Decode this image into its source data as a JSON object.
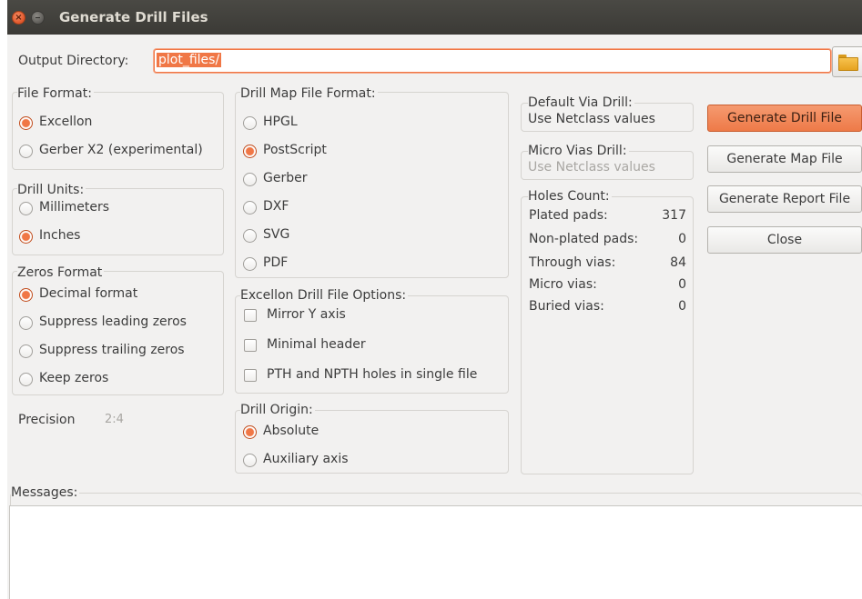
{
  "window": {
    "title": "Generate Drill Files"
  },
  "output": {
    "label": "Output Directory:",
    "value": "plot_files/"
  },
  "file_format": {
    "title": "File Format:",
    "options": [
      "Excellon",
      "Gerber X2 (experimental)"
    ],
    "selected": "Excellon"
  },
  "drill_units": {
    "title": "Drill Units:",
    "options": [
      "Millimeters",
      "Inches"
    ],
    "selected": "Inches"
  },
  "zeros_format": {
    "title": "Zeros Format",
    "options": [
      "Decimal format",
      "Suppress leading zeros",
      "Suppress trailing zeros",
      "Keep zeros"
    ],
    "selected": "Decimal format"
  },
  "precision": {
    "label": "Precision",
    "value": "2:4"
  },
  "drill_map": {
    "title": "Drill Map File Format:",
    "options": [
      "HPGL",
      "PostScript",
      "Gerber",
      "DXF",
      "SVG",
      "PDF"
    ],
    "selected": "PostScript"
  },
  "excellon_opts": {
    "title": "Excellon Drill File Options:",
    "options": [
      "Mirror Y axis",
      "Minimal header",
      "PTH and NPTH holes in single file"
    ]
  },
  "drill_origin": {
    "title": "Drill Origin:",
    "options": [
      "Absolute",
      "Auxiliary axis"
    ],
    "selected": "Absolute"
  },
  "via_drill": {
    "title": "Default Via Drill:",
    "value": "Use Netclass values"
  },
  "micro_via_drill": {
    "title": "Micro Vias Drill:",
    "value": "Use Netclass values"
  },
  "holes": {
    "title": "Holes Count:",
    "rows": [
      {
        "label": "Plated pads:",
        "value": "317"
      },
      {
        "label": "Non-plated pads:",
        "value": "0"
      },
      {
        "label": "Through vias:",
        "value": "84"
      },
      {
        "label": "Micro vias:",
        "value": "0"
      },
      {
        "label": "Buried vias:",
        "value": "0"
      }
    ]
  },
  "buttons": {
    "generate_drill": "Generate Drill File",
    "generate_map": "Generate Map File",
    "generate_report": "Generate Report File",
    "close": "Close"
  },
  "messages": {
    "title": "Messages:"
  },
  "colors": {
    "accent": "#f07746",
    "titlebar": "#3c3b37",
    "dialog_bg": "#f2f1f0"
  }
}
